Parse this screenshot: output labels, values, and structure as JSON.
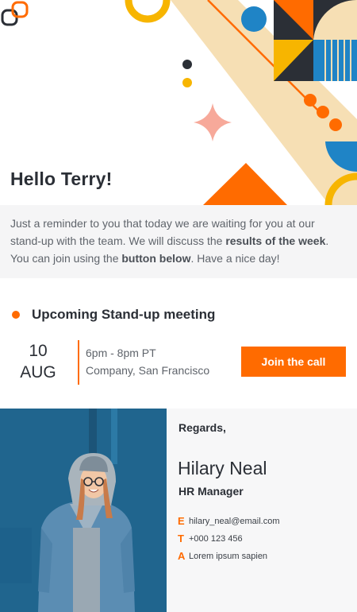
{
  "colors": {
    "accent": "#ff6b00",
    "dark": "#2b2f36",
    "muted": "#5f646b",
    "light_bg": "#f5f5f6"
  },
  "hero": {
    "logo": "interlocking-squares-logo",
    "greeting": "Hello Terry!"
  },
  "intro": {
    "text_1": "Just a reminder to you that today we are waiting for you at our stand-up with the team. We will discuss the ",
    "bold_1": "results of the week",
    "text_2": ". You can join using the ",
    "bold_2": "button below",
    "text_3": ". Have a nice day!"
  },
  "meeting": {
    "title": "Upcoming Stand-up meeting",
    "day": "10",
    "month": "AUG",
    "time": "6pm - 8pm PT",
    "place": "Company, San Francisco",
    "join_label": "Join the call"
  },
  "signature": {
    "regards": "Regards,",
    "name": "Hilary Neal",
    "role": "HR Manager",
    "email_letter": "E",
    "email": "hilary_neal@email.com",
    "phone_letter": "T",
    "phone": "+000 123 456",
    "address_letter": "A",
    "address": "Lorem ipsum sapien"
  }
}
